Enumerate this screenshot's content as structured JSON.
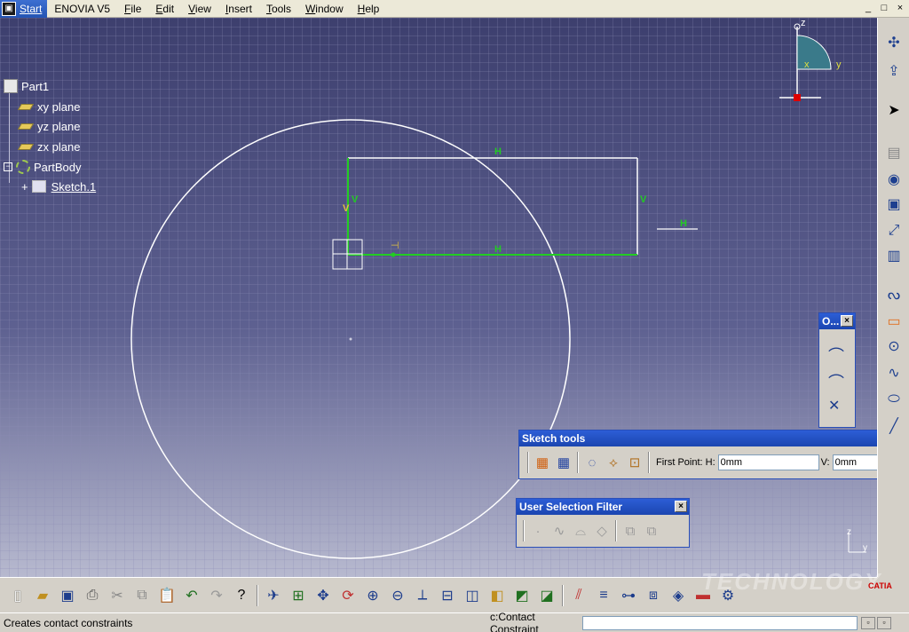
{
  "menubar": {
    "start": "Start",
    "items": [
      "ENOVIA V5",
      "File",
      "Edit",
      "View",
      "Insert",
      "Tools",
      "Window",
      "Help"
    ],
    "window_controls": [
      "_",
      "□",
      "×"
    ]
  },
  "tree": {
    "root": "Part1",
    "planes": [
      "xy plane",
      "yz plane",
      "zx plane"
    ],
    "body": "PartBody",
    "sketch": "Sketch.1"
  },
  "compass": {
    "z": "z",
    "x": "x",
    "y": "y"
  },
  "sketch": {
    "h_label": "H",
    "v_label": "V",
    "tangent_mark": "⊣"
  },
  "sketch_tools": {
    "title": "Sketch tools",
    "first_point_label": "First Point: H:",
    "h_value": "0mm",
    "v_label": "V:",
    "v_value": "0mm"
  },
  "selection_filter": {
    "title": "User Selection Filter",
    "close": "×"
  },
  "profile_toolbar": {
    "title": "O...",
    "close": "×"
  },
  "axis_small": {
    "z": "z",
    "y": "y"
  },
  "watermark": "TECHNOLOGY",
  "logo": "CATIA",
  "status": {
    "message": "Creates contact constraints",
    "command": "c:Contact Constraint",
    "input_value": ""
  },
  "colors": {
    "constraint_green": "#22cc22",
    "geometry_white": "#ffffff",
    "titlebar_blue": "#1b45b0"
  }
}
